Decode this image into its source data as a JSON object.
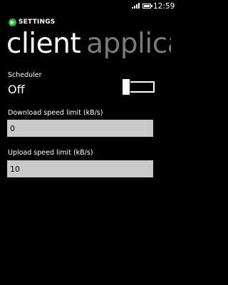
{
  "status_bar": {
    "time": "12:59",
    "signal_icon": "signal-icon",
    "battery_icon": "battery-icon"
  },
  "header": {
    "app_title": "SETTINGS",
    "logo_icon": "app-logo-icon",
    "logo_color": "#3cb043"
  },
  "pivot": {
    "items": [
      {
        "label": "client",
        "active": true
      },
      {
        "label": "application",
        "active": false
      }
    ]
  },
  "settings": {
    "scheduler": {
      "label": "Scheduler",
      "state": "Off",
      "on": false
    },
    "download_limit": {
      "label": "Download speed limit (kB/s)",
      "value": "0"
    },
    "upload_limit": {
      "label": "Upload speed limit (kB/s)",
      "value": "10"
    }
  },
  "colors": {
    "background": "#000000",
    "text": "#ffffff",
    "inactive_pivot": "#7a7a7a",
    "input_background": "#c9c9c9"
  }
}
